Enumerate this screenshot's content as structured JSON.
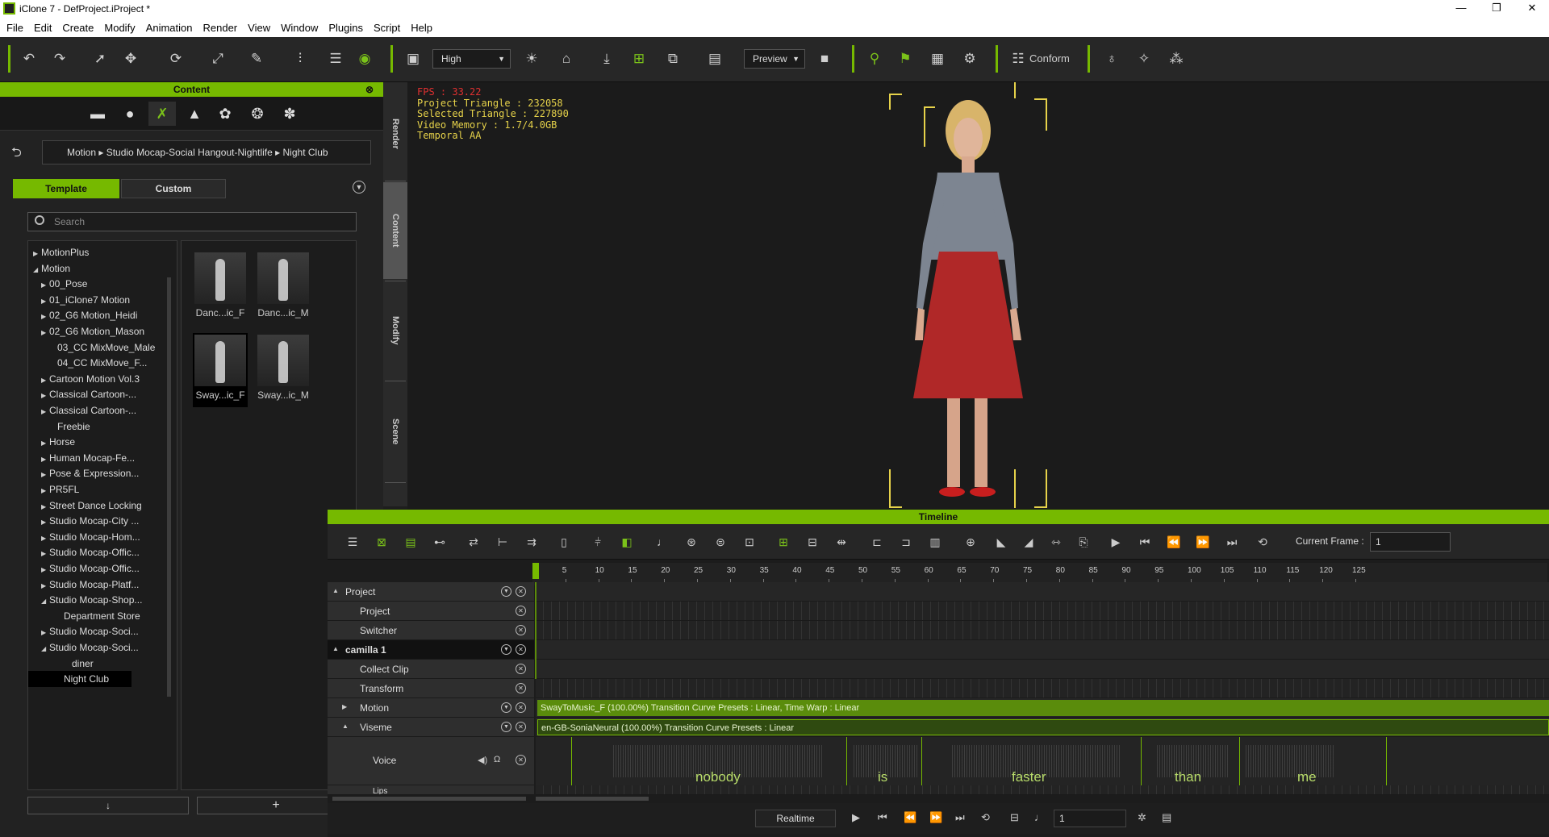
{
  "window": {
    "title": "iClone 7 - DefProject.iProject *",
    "minimize": "—",
    "restore": "❐",
    "close": "✕"
  },
  "menu": [
    "File",
    "Edit",
    "Create",
    "Modify",
    "Animation",
    "Render",
    "View",
    "Window",
    "Plugins",
    "Script",
    "Help"
  ],
  "toolbar": {
    "quality": "High",
    "preview": "Preview",
    "conform": "Conform"
  },
  "content": {
    "title": "Content",
    "breadcrumb": "Motion ▸ Studio Mocap-Social Hangout-Nightlife ▸ Night Club",
    "tab_template": "Template",
    "tab_custom": "Custom",
    "search_placeholder": "Search",
    "tree": [
      {
        "label": "MotionPlus",
        "toggle": "▶"
      },
      {
        "label": "Motion",
        "toggle": "◢"
      },
      {
        "label": "00_Pose",
        "toggle": "▶"
      },
      {
        "label": "01_iClone7 Motion",
        "toggle": "▶"
      },
      {
        "label": "02_G6 Motion_Heidi",
        "toggle": "▶"
      },
      {
        "label": "02_G6 Motion_Mason",
        "toggle": "▶"
      },
      {
        "label": "03_CC MixMove_Male",
        "toggle": ""
      },
      {
        "label": "04_CC MixMove_F...",
        "toggle": ""
      },
      {
        "label": "Cartoon Motion Vol.3",
        "toggle": "▶"
      },
      {
        "label": "Classical Cartoon-...",
        "toggle": "▶"
      },
      {
        "label": "Classical Cartoon-...",
        "toggle": "▶"
      },
      {
        "label": "Freebie",
        "toggle": ""
      },
      {
        "label": "Horse",
        "toggle": "▶"
      },
      {
        "label": "Human Mocap-Fe...",
        "toggle": "▶"
      },
      {
        "label": "Pose & Expression...",
        "toggle": "▶"
      },
      {
        "label": "PR5FL",
        "toggle": "▶"
      },
      {
        "label": "Street Dance Locking",
        "toggle": "▶"
      },
      {
        "label": "Studio Mocap-City ...",
        "toggle": "▶"
      },
      {
        "label": "Studio Mocap-Hom...",
        "toggle": "▶"
      },
      {
        "label": "Studio Mocap-Offic...",
        "toggle": "▶"
      },
      {
        "label": "Studio Mocap-Offic...",
        "toggle": "▶"
      },
      {
        "label": "Studio Mocap-Platf...",
        "toggle": "▶"
      },
      {
        "label": "Studio Mocap-Shop...",
        "toggle": "◢"
      },
      {
        "label": "Department Store",
        "toggle": ""
      },
      {
        "label": "Studio Mocap-Soci...",
        "toggle": "▶"
      },
      {
        "label": "Studio Mocap-Soci...",
        "toggle": "◢"
      },
      {
        "label": "diner",
        "toggle": ""
      },
      {
        "label": "Night Club",
        "toggle": ""
      }
    ],
    "thumbs": [
      "Danc...ic_F",
      "Danc...ic_M",
      "Sway...ic_F",
      "Sway...ic_M"
    ],
    "down_btn": "↓",
    "add_btn": "+"
  },
  "side_tabs": [
    "Render",
    "Content",
    "Modify",
    "Scene"
  ],
  "viewport": {
    "fps": "FPS : 33.22",
    "project_triangle": "Project Triangle : 232058",
    "selected_triangle": "Selected Triangle : 227890",
    "video_memory": "Video Memory : 1.7/4.0GB",
    "aa": "Temporal AA"
  },
  "timeline": {
    "title": "Timeline",
    "current_frame_label": "Current Frame :",
    "current_frame": "1",
    "ruler": [
      "5",
      "10",
      "15",
      "20",
      "25",
      "30",
      "35",
      "40",
      "45",
      "50",
      "55",
      "60",
      "65",
      "70",
      "75",
      "80",
      "85",
      "90",
      "95",
      "100",
      "105",
      "110",
      "115",
      "120",
      "125"
    ],
    "tracks": {
      "project": "Project",
      "project_sub": "Project",
      "switcher": "Switcher",
      "camilla": "camilla 1",
      "collect_clip": "Collect Clip",
      "transform": "Transform",
      "motion": "Motion",
      "viseme": "Viseme",
      "voice": "Voice",
      "lips": "Lips"
    },
    "motion_clip": "SwayToMusic_F (100.00%) Transition Curve Presets : Linear, Time Warp : Linear",
    "viseme_clip": "en-GB-SoniaNeural (100.00%) Transition Curve Presets : Linear",
    "words": [
      "nobody",
      "is",
      "faster",
      "than",
      "me"
    ],
    "realtime": "Realtime",
    "frame": "1"
  },
  "colors": {
    "accent": "#76b900"
  }
}
